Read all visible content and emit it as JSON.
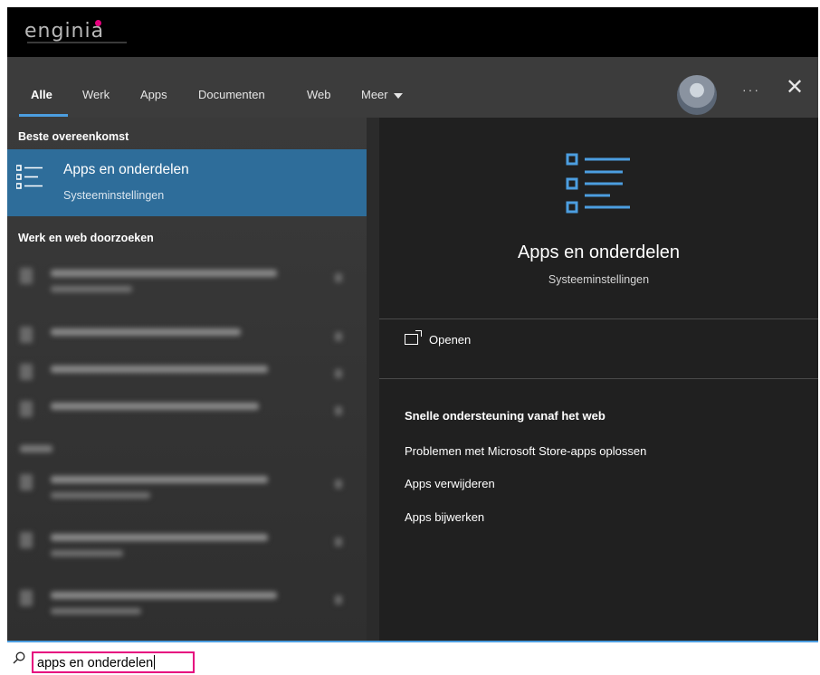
{
  "brand": {
    "logo_text": "enginia"
  },
  "tabs": [
    {
      "label": "Alle",
      "active": true
    },
    {
      "label": "Werk"
    },
    {
      "label": "Apps"
    },
    {
      "label": "Documenten"
    },
    {
      "label": "Web"
    },
    {
      "label": "Meer"
    }
  ],
  "header": {
    "more_options": "···",
    "close": "✕"
  },
  "left": {
    "best_match_label": "Beste overeenkomst",
    "best_match": {
      "title": "Apps en onderdelen",
      "subtitle": "Systeeminstellingen",
      "icon": "list-settings-icon"
    },
    "work_web_label": "Werk en web doorzoeken"
  },
  "right": {
    "title": "Apps en onderdelen",
    "subtitle": "Systeeminstellingen",
    "open_label": "Openen",
    "web_heading": "Snelle ondersteuning vanaf het web",
    "web_links": [
      "Problemen met Microsoft Store-apps oplossen",
      "Apps verwijderen",
      "Apps bijwerken"
    ]
  },
  "search": {
    "value": "apps en onderdelen"
  },
  "colors": {
    "accent": "#4c9ee0",
    "highlight": "#e6007e",
    "selected": "#2e6d9a",
    "logo_dot": "#e6007e"
  }
}
